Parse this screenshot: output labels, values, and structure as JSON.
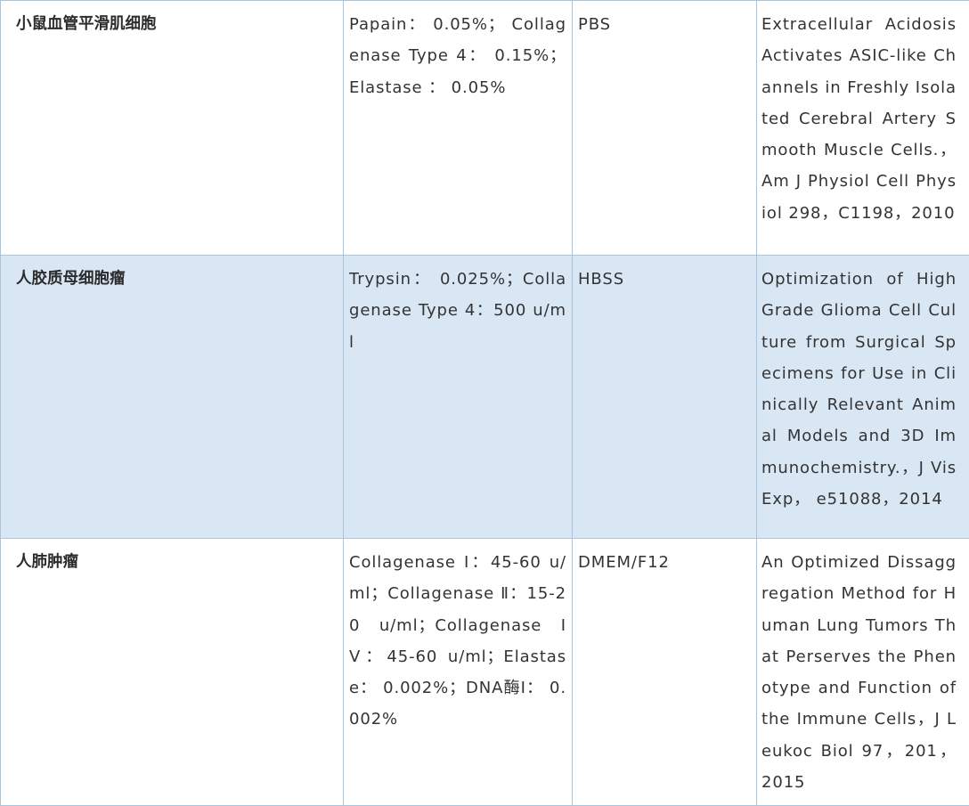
{
  "rows": [
    {
      "cell_type": "小鼠血管平滑肌细胞",
      "enzymes": "Papain： 0.05%； Collagenase Type 4： 0.15%；Elastase ： 0.05%",
      "buffer": "PBS",
      "reference": "Extracellular Acidosis Activates ASIC-like Channels in Freshly Isolated Cerebral Artery Smooth Muscle Cells.，Am J Physiol Cell Physiol 298，C1198，2010"
    },
    {
      "cell_type": "人胶质母细胞瘤",
      "enzymes": "Trypsin： 0.025%；Collagenase Type 4：500 u/ml",
      "buffer": "HBSS",
      "reference": "Optimization of High Grade Glioma Cell Culture from Surgical Specimens for Use in Clinically Relevant Animal Models and 3D Immunochemistry.，J Vis Exp， e51088，2014"
    },
    {
      "cell_type": "人肺肿瘤",
      "enzymes": "Collagenase Ⅰ：45-60 u/ml；Collagenase Ⅱ：15-20 u/ml；Collagenase IV：45-60 u/ml；Elastase： 0.002%；DNA酶Ⅰ： 0.002%",
      "buffer": "DMEM/F12",
      "reference": "An Optimized Dissaggregation Method for Human Lung Tumors That Perserves the Phenotype and Function of the Immune Cells，J Leukoc Biol 97，201，2015"
    }
  ]
}
